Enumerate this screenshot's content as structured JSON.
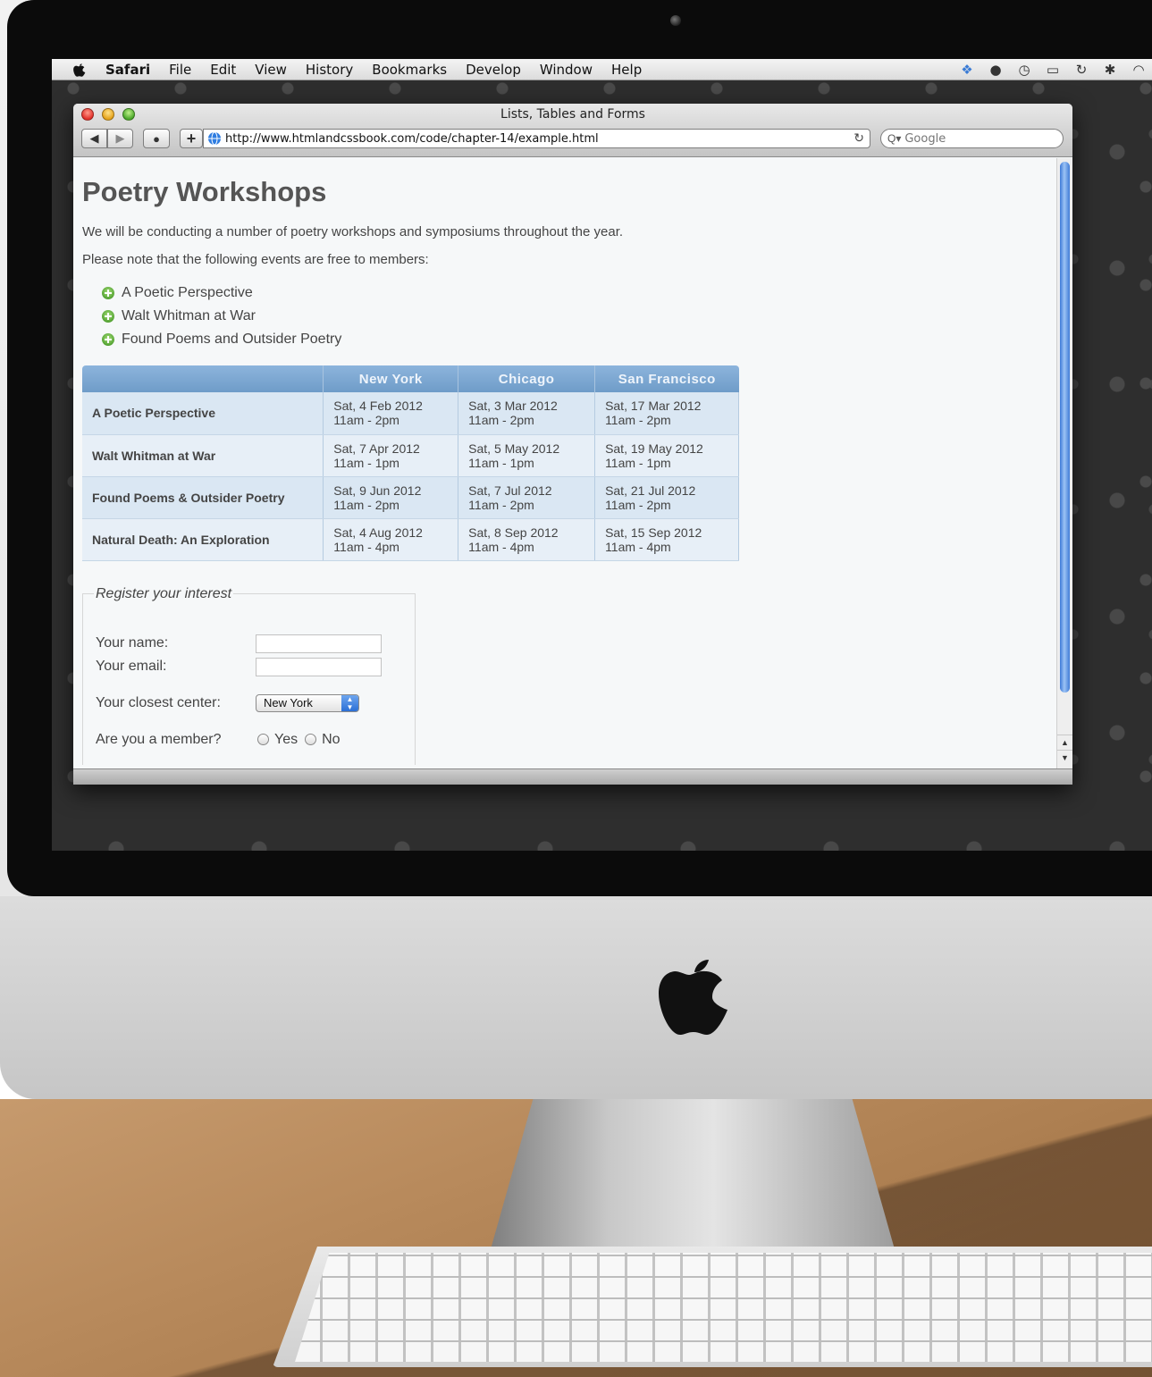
{
  "menubar": {
    "items": [
      "Safari",
      "File",
      "Edit",
      "View",
      "History",
      "Bookmarks",
      "Develop",
      "Window",
      "Help"
    ],
    "status_icons": [
      "dropbox-icon",
      "evernote-icon",
      "time-machine-icon",
      "display-icon",
      "sync-icon",
      "bluetooth-icon",
      "wifi-icon"
    ]
  },
  "window": {
    "title": "Lists, Tables and Forms",
    "url": "http://www.htmlandcssbook.com/code/chapter-14/example.html",
    "search_placeholder": "Google"
  },
  "page": {
    "title": "Poetry Workshops",
    "intro": "We will be conducting a number of poetry workshops and symposiums throughout the year.",
    "note": "Please note that the following events are free to members:",
    "events": [
      "A Poetic Perspective",
      "Walt Whitman at War",
      "Found Poems and Outsider Poetry"
    ]
  },
  "schedule": {
    "headers": [
      "",
      "New York",
      "Chicago",
      "San Francisco"
    ],
    "rows": [
      {
        "event": "A Poetic Perspective",
        "cells": [
          {
            "date": "Sat, 4 Feb 2012",
            "time": "11am - 2pm"
          },
          {
            "date": "Sat, 3 Mar 2012",
            "time": "11am - 2pm"
          },
          {
            "date": "Sat, 17 Mar 2012",
            "time": "11am - 2pm"
          }
        ]
      },
      {
        "event": "Walt Whitman at War",
        "cells": [
          {
            "date": "Sat, 7 Apr 2012",
            "time": "11am - 1pm"
          },
          {
            "date": "Sat, 5 May 2012",
            "time": "11am - 1pm"
          },
          {
            "date": "Sat, 19 May 2012",
            "time": "11am - 1pm"
          }
        ]
      },
      {
        "event": "Found Poems & Outsider Poetry",
        "cells": [
          {
            "date": "Sat, 9 Jun 2012",
            "time": "11am - 2pm"
          },
          {
            "date": "Sat, 7 Jul 2012",
            "time": "11am - 2pm"
          },
          {
            "date": "Sat, 21 Jul 2012",
            "time": "11am - 2pm"
          }
        ]
      },
      {
        "event": "Natural Death: An Exploration",
        "cells": [
          {
            "date": "Sat, 4 Aug 2012",
            "time": "11am - 4pm"
          },
          {
            "date": "Sat, 8 Sep 2012",
            "time": "11am - 4pm"
          },
          {
            "date": "Sat, 15 Sep 2012",
            "time": "11am - 4pm"
          }
        ]
      }
    ]
  },
  "form": {
    "legend": "Register your interest",
    "name_label": "Your name:",
    "name_value": "",
    "email_label": "Your email:",
    "email_value": "",
    "center_label": "Your closest center:",
    "center_selected": "New York",
    "member_label": "Are you a member?",
    "yes_label": "Yes",
    "no_label": "No"
  },
  "colors": {
    "table_header": "#7ba6d2",
    "row_odd": "#dae7f3",
    "row_even": "#e7eff7",
    "scroll_thumb": "#5b93e6"
  }
}
